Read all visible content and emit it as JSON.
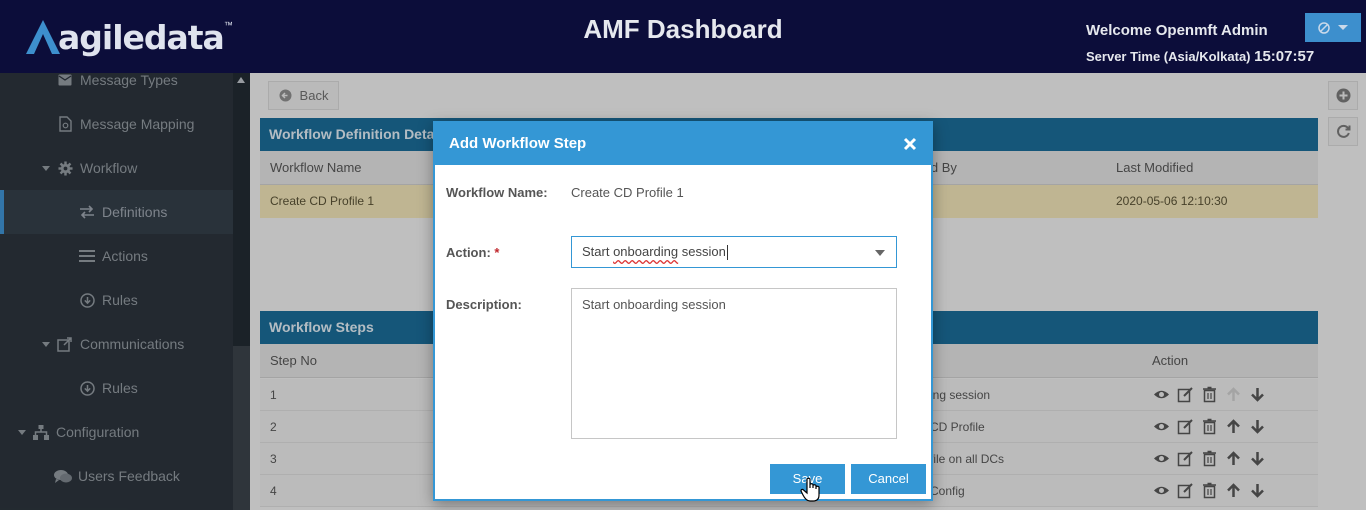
{
  "header": {
    "logo_text": "agiledata",
    "logo_tm": "™",
    "title": "AMF Dashboard",
    "welcome": "Welcome Openmft Admin",
    "server_time_label": "Server Time (Asia/Kolkata)",
    "server_time": "15:07:57"
  },
  "sidebar": {
    "items": [
      {
        "label": "Message Types",
        "icon": "envelope-icon"
      },
      {
        "label": "Message Mapping",
        "icon": "file-map-icon"
      },
      {
        "label": "Workflow",
        "icon": "gear-icon"
      },
      {
        "label": "Definitions",
        "icon": "exchange-icon"
      },
      {
        "label": "Actions",
        "icon": "list-icon"
      },
      {
        "label": "Rules",
        "icon": "circle-arrow-icon"
      },
      {
        "label": "Communications",
        "icon": "share-icon"
      },
      {
        "label": "Rules",
        "icon": "circle-arrow-icon"
      },
      {
        "label": "Configuration",
        "icon": "sitemap-icon"
      },
      {
        "label": "Users Feedback",
        "icon": "comments-icon"
      }
    ]
  },
  "main": {
    "back_label": "Back",
    "definition_panel_title": "Workflow Definition Details",
    "definition_columns": {
      "name": "Workflow Name",
      "modified_by": "Modified By",
      "last_modified": "Last Modified"
    },
    "definition_row": {
      "name": "Create CD Profile 1",
      "last_modified": "2020-05-06 12:10:30"
    },
    "steps_panel_title": "Workflow Steps",
    "steps_columns": {
      "step_no": "Step No",
      "action": "Action"
    },
    "steps": [
      {
        "no": "1",
        "desc": "ing session"
      },
      {
        "no": "2",
        "desc": "CD Profile"
      },
      {
        "no": "3",
        "desc": "file on all DCs"
      },
      {
        "no": "4",
        "desc": "Config"
      }
    ]
  },
  "modal": {
    "title": "Add Workflow Step",
    "workflow_name_label": "Workflow Name:",
    "workflow_name_value": "Create CD Profile 1",
    "action_label": "Action:",
    "required_mark": "*",
    "action_value_prefix": "Start ",
    "action_value_squiggle": "onboarding",
    "action_value_suffix": " session",
    "description_label": "Description:",
    "description_value": "Start onboarding session",
    "save_label": "Save",
    "cancel_label": "Cancel"
  },
  "colors": {
    "header_bg": "#0c0d3a",
    "sidebar_bg": "#2b333b",
    "panel_head": "#1a6a94",
    "accent": "#3497d5",
    "highlight_row": "#e9ddb3"
  }
}
